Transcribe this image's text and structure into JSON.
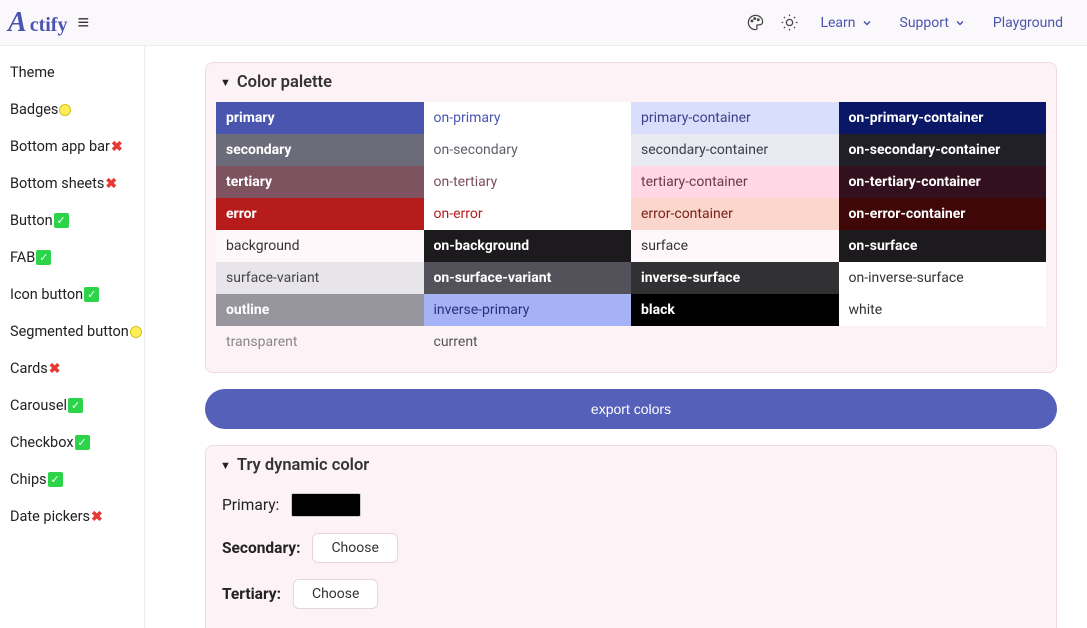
{
  "header": {
    "brand_initial": "A",
    "brand_rest": "ctify",
    "learn_label": "Learn",
    "support_label": "Support",
    "playground_label": "Playground"
  },
  "sidebar": {
    "items": [
      {
        "label": "Theme",
        "badge": ""
      },
      {
        "label": "Badges",
        "badge": "dot"
      },
      {
        "label": "Bottom app bar",
        "badge": "cross"
      },
      {
        "label": "Bottom sheets",
        "badge": "cross"
      },
      {
        "label": "Button",
        "badge": "check"
      },
      {
        "label": "FAB",
        "badge": "check"
      },
      {
        "label": "Icon button",
        "badge": "check"
      },
      {
        "label": "Segmented button",
        "badge": "dot"
      },
      {
        "label": "Cards",
        "badge": "cross"
      },
      {
        "label": "Carousel",
        "badge": "check"
      },
      {
        "label": "Checkbox",
        "badge": "check"
      },
      {
        "label": "Chips",
        "badge": "check"
      },
      {
        "label": "Date pickers",
        "badge": "cross"
      }
    ]
  },
  "palette_card": {
    "title": "Color palette",
    "swatches": [
      {
        "name": "primary",
        "bg": "#4a55b0",
        "fg": "#ffffff",
        "bold": true
      },
      {
        "name": "on-primary",
        "bg": "#ffffff",
        "fg": "#4a55b0",
        "bold": false
      },
      {
        "name": "primary-container",
        "bg": "#d9defc",
        "fg": "#3b3f8c",
        "bold": false
      },
      {
        "name": "on-primary-container",
        "bg": "#0a1766",
        "fg": "#ffffff",
        "bold": true
      },
      {
        "name": "secondary",
        "bg": "#6b6b79",
        "fg": "#ffffff",
        "bold": true
      },
      {
        "name": "on-secondary",
        "bg": "#ffffff",
        "fg": "#5f5f6b",
        "bold": false
      },
      {
        "name": "secondary-container",
        "bg": "#e9e9f1",
        "fg": "#3c3c4a",
        "bold": false
      },
      {
        "name": "on-secondary-container",
        "bg": "#212029",
        "fg": "#ffffff",
        "bold": true
      },
      {
        "name": "tertiary",
        "bg": "#7e5360",
        "fg": "#ffffff",
        "bold": true
      },
      {
        "name": "on-tertiary",
        "bg": "#ffffff",
        "fg": "#7a4f5d",
        "bold": false
      },
      {
        "name": "tertiary-container",
        "bg": "#ffd7e5",
        "fg": "#6b3947",
        "bold": false
      },
      {
        "name": "on-tertiary-container",
        "bg": "#33101d",
        "fg": "#ffffff",
        "bold": true
      },
      {
        "name": "error",
        "bg": "#b61c1c",
        "fg": "#ffffff",
        "bold": true
      },
      {
        "name": "on-error",
        "bg": "#ffffff",
        "fg": "#b61c1c",
        "bold": false
      },
      {
        "name": "error-container",
        "bg": "#fbd6cd",
        "fg": "#7a2318",
        "bold": false
      },
      {
        "name": "on-error-container",
        "bg": "#3f0707",
        "fg": "#ffffff",
        "bold": true
      },
      {
        "name": "background",
        "bg": "#fff8fa",
        "fg": "#333333",
        "bold": false
      },
      {
        "name": "on-background",
        "bg": "#1c1a1d",
        "fg": "#ffffff",
        "bold": true
      },
      {
        "name": "surface",
        "bg": "#fff8fa",
        "fg": "#333333",
        "bold": false
      },
      {
        "name": "on-surface",
        "bg": "#1c1a1d",
        "fg": "#ffffff",
        "bold": true
      },
      {
        "name": "surface-variant",
        "bg": "#e7e5ea",
        "fg": "#444444",
        "bold": false
      },
      {
        "name": "on-surface-variant",
        "bg": "#53525a",
        "fg": "#ffffff",
        "bold": true
      },
      {
        "name": "inverse-surface",
        "bg": "#313033",
        "fg": "#ffffff",
        "bold": true
      },
      {
        "name": "on-inverse-surface",
        "bg": "#ffffff",
        "fg": "#333333",
        "bold": false
      },
      {
        "name": "outline",
        "bg": "#97969e",
        "fg": "#ffffff",
        "bold": true
      },
      {
        "name": "inverse-primary",
        "bg": "#a5b2f6",
        "fg": "#2a2f7c",
        "bold": false
      },
      {
        "name": "black",
        "bg": "#000000",
        "fg": "#ffffff",
        "bold": true
      },
      {
        "name": "white",
        "bg": "#ffffff",
        "fg": "#333333",
        "bold": false
      },
      {
        "name": "transparent",
        "bg": "#fdf2f6",
        "fg": "#888888",
        "bold": false
      },
      {
        "name": "current",
        "bg": "#fdf2f6",
        "fg": "#555555",
        "bold": false
      }
    ]
  },
  "export_button": "export colors",
  "dynamic_card": {
    "title": "Try dynamic color",
    "primary_label": "Primary:",
    "primary_value": "#000000",
    "secondary_label": "Secondary:",
    "tertiary_label": "Tertiary:",
    "choose_label": "Choose"
  }
}
